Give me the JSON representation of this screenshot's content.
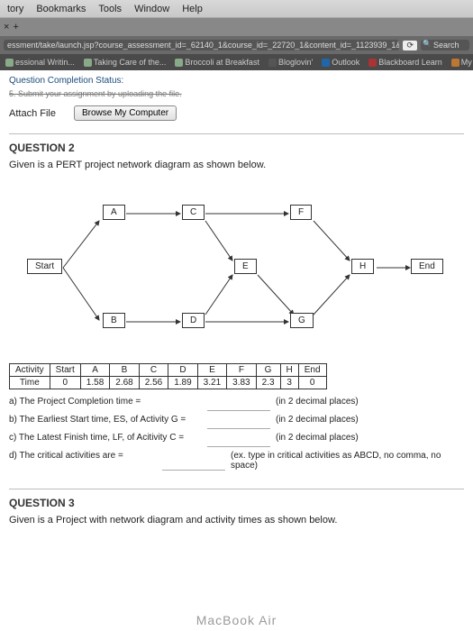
{
  "menu": {
    "items": [
      "tory",
      "Bookmarks",
      "Tools",
      "Window",
      "Help"
    ]
  },
  "tabs": {
    "close": "×",
    "plus": "+"
  },
  "url": {
    "text": "essment/take/launch.jsp?course_assessment_id=_62140_1&course_id=_22720_1&content_id=_1123939_1&",
    "refresh": "⟳",
    "search": "Search"
  },
  "bookmarks": {
    "items": [
      "essional Writin...",
      "Taking Care of the...",
      "Broccoli at Breakfast",
      "Bloglovin'",
      "Outlook",
      "Blackboard Learn",
      "My AUM"
    ]
  },
  "bb": {
    "status": "Question Completion Status:",
    "step": "5. Submit your assignment by uploading the file."
  },
  "attach": {
    "label": "Attach File",
    "btn": "Browse My Computer"
  },
  "q2": {
    "header": "QUESTION 2",
    "text": "Given is a PERT project network diagram as shown below.",
    "nodes": {
      "A": "A",
      "B": "B",
      "C": "C",
      "D": "D",
      "E": "E",
      "F": "F",
      "G": "G",
      "H": "H",
      "Start": "Start",
      "End": "End"
    },
    "answers": {
      "a": {
        "lbl": "a) The Project Completion time =",
        "hint": "(in 2 decimal places)"
      },
      "b": {
        "lbl": "b) The Earliest Start time, ES, of Activity G =",
        "hint": "(in 2 decimal places)"
      },
      "c": {
        "lbl": "c) The Latest Finish time, LF, of Acitivity C =",
        "hint": "(in 2 decimal places)"
      },
      "d": {
        "lbl": "d) The critical activities are =",
        "hint": "(ex. type in critical activities as ABCD, no comma, no space)"
      }
    }
  },
  "q3": {
    "header": "QUESTION 3",
    "text": "Given is a Project with network diagram and activity times as shown below."
  },
  "footer": "MacBook Air",
  "chart_data": {
    "type": "table",
    "title": "PERT activity times",
    "columns": [
      "Activity",
      "Start",
      "A",
      "B",
      "C",
      "D",
      "E",
      "F",
      "G",
      "H",
      "End"
    ],
    "rows": [
      {
        "label": "Time",
        "values": [
          0,
          1.58,
          2.68,
          2.56,
          1.89,
          3.21,
          3.83,
          2.3,
          3.0,
          0
        ]
      }
    ],
    "network": {
      "nodes": [
        "Start",
        "A",
        "B",
        "C",
        "D",
        "E",
        "F",
        "G",
        "H",
        "End"
      ],
      "edges": [
        [
          "Start",
          "A"
        ],
        [
          "Start",
          "B"
        ],
        [
          "A",
          "C"
        ],
        [
          "B",
          "D"
        ],
        [
          "C",
          "E"
        ],
        [
          "C",
          "F"
        ],
        [
          "D",
          "E"
        ],
        [
          "D",
          "G"
        ],
        [
          "E",
          "G"
        ],
        [
          "F",
          "H"
        ],
        [
          "G",
          "H"
        ],
        [
          "H",
          "End"
        ]
      ]
    }
  }
}
